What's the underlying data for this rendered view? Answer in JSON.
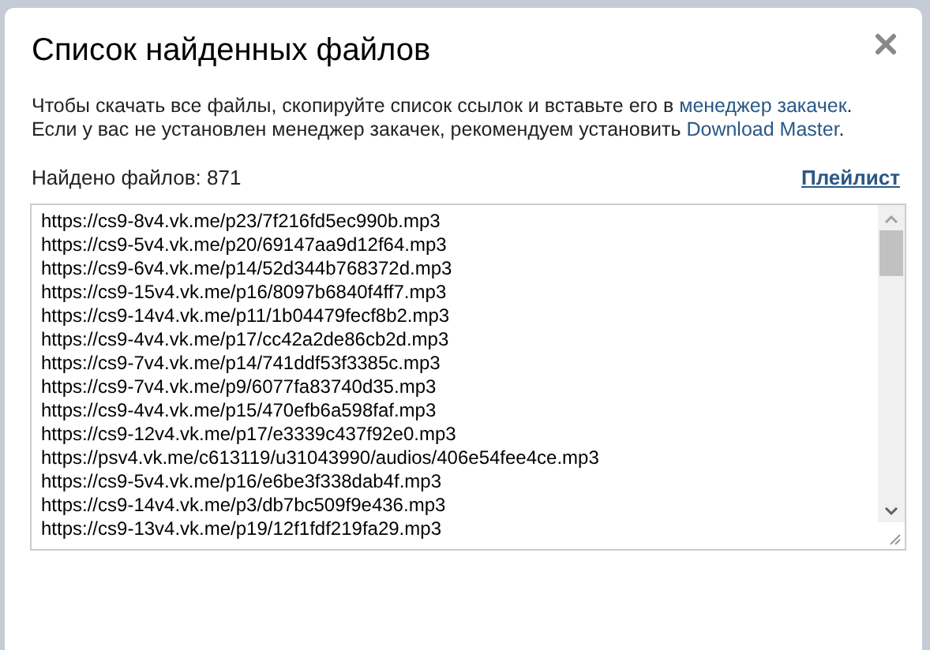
{
  "dialog": {
    "title": "Список найденных файлов",
    "description": [
      {
        "kind": "text",
        "text": "Чтобы скачать все файлы, скопируйте список ссылок и вставьте его в "
      },
      {
        "kind": "link",
        "text": "менеджер закачек"
      },
      {
        "kind": "text",
        "text": ". Если у вас не установлен менеджер закачек, рекомендуем установить "
      },
      {
        "kind": "link",
        "text": "Download Master"
      },
      {
        "kind": "text",
        "text": "."
      }
    ],
    "found_label": "Найдено файлов: 871",
    "playlist_link": "Плейлист",
    "links": [
      "https://cs9-8v4.vk.me/p23/7f216fd5ec990b.mp3",
      "https://cs9-5v4.vk.me/p20/69147aa9d12f64.mp3",
      "https://cs9-6v4.vk.me/p14/52d344b768372d.mp3",
      "https://cs9-15v4.vk.me/p16/8097b6840f4ff7.mp3",
      "https://cs9-14v4.vk.me/p11/1b04479fecf8b2.mp3",
      "https://cs9-4v4.vk.me/p17/cc42a2de86cb2d.mp3",
      "https://cs9-7v4.vk.me/p14/741ddf53f3385c.mp3",
      "https://cs9-7v4.vk.me/p9/6077fa83740d35.mp3",
      "https://cs9-4v4.vk.me/p15/470efb6a598faf.mp3",
      "https://cs9-12v4.vk.me/p17/e3339c437f92e0.mp3",
      "https://psv4.vk.me/c613119/u31043990/audios/406e54fee4ce.mp3",
      "https://cs9-5v4.vk.me/p16/e6be3f338dab4f.mp3",
      "https://cs9-14v4.vk.me/p3/db7bc509f9e436.mp3",
      "https://cs9-13v4.vk.me/p19/12f1fdf219fa29.mp3"
    ]
  }
}
